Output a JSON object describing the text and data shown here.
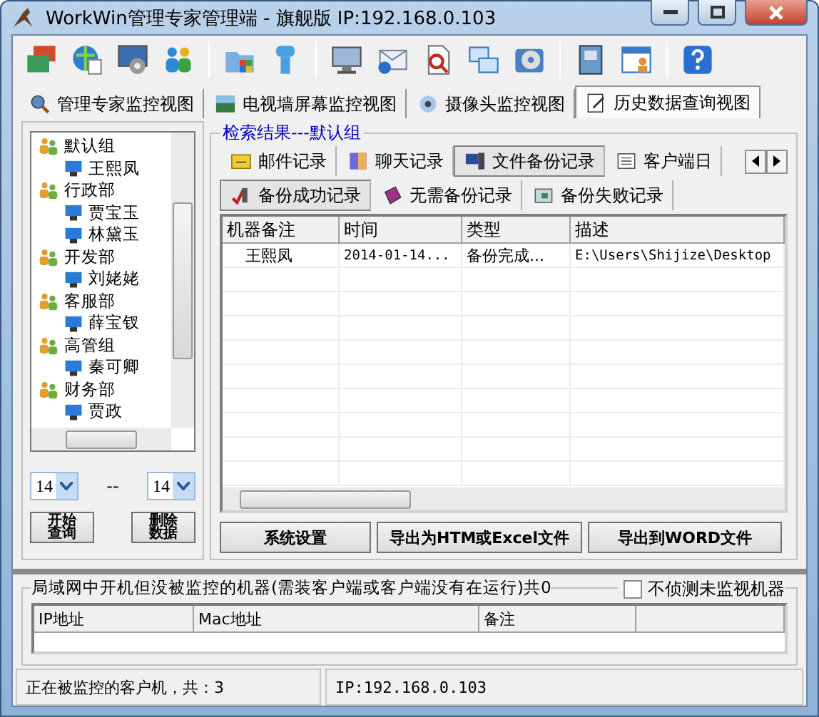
{
  "window": {
    "title": "WorkWin管理专家管理端 - 旗舰版 IP:192.168.0.103"
  },
  "view_tabs": [
    {
      "label": "管理专家监控视图",
      "selected": false
    },
    {
      "label": "电视墙屏幕监控视图",
      "selected": false
    },
    {
      "label": "摄像头监控视图",
      "selected": false
    },
    {
      "label": "历史数据查询视图",
      "selected": true
    }
  ],
  "tree": [
    {
      "label": "默认组",
      "children": [
        {
          "label": "王熙凤"
        }
      ]
    },
    {
      "label": "行政部",
      "children": [
        {
          "label": "贾宝玉"
        },
        {
          "label": "林黛玉"
        }
      ]
    },
    {
      "label": "开发部",
      "children": [
        {
          "label": "刘姥姥"
        }
      ]
    },
    {
      "label": "客服部",
      "children": [
        {
          "label": "薛宝钗"
        }
      ]
    },
    {
      "label": "高管组",
      "children": [
        {
          "label": "秦可卿"
        }
      ]
    },
    {
      "label": "财务部",
      "children": [
        {
          "label": "贾政"
        }
      ]
    }
  ],
  "date_from": "14",
  "range_separator": "--",
  "date_to": "14",
  "left_buttons": [
    "开始查询",
    "删除数据"
  ],
  "results": {
    "title": "检索结果---默认组",
    "record_tabs": [
      {
        "label": "邮件记录",
        "selected": false
      },
      {
        "label": "聊天记录",
        "selected": false
      },
      {
        "label": "文件备份记录",
        "selected": true
      },
      {
        "label": "客户端日",
        "selected": false
      }
    ],
    "sub_tabs": [
      {
        "label": "备份成功记录",
        "selected": true
      },
      {
        "label": "无需备份记录",
        "selected": false
      },
      {
        "label": "备份失败记录",
        "selected": false
      }
    ],
    "columns": [
      "机器备注",
      "时间",
      "类型",
      "描述"
    ],
    "rows": [
      [
        "王熙凤",
        "2014-01-14...",
        "备份完成...",
        "E:\\Users\\Shijize\\Desktop"
      ]
    ]
  },
  "action_buttons": [
    "系统设置",
    "导出为HTM或Excel文件",
    "导出到WORD文件"
  ],
  "unmonitored": {
    "title": "局域网中开机但没被监控的机器(需装客户端或客户端没有在运行)共0",
    "ignore": {
      "label": "不侦测未监视机器",
      "checked": false
    },
    "columns": [
      "IP地址",
      "Mac地址",
      "备注"
    ]
  },
  "status_bar": [
    "正在被监控的客户机，共：3",
    "IP:192.168.0.103"
  ]
}
